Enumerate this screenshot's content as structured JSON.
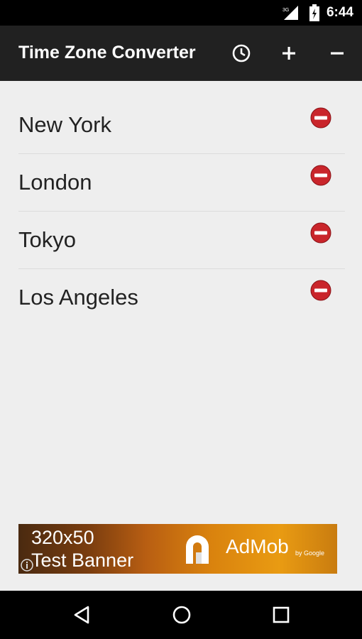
{
  "status_bar": {
    "network_label": "3G",
    "time": "6:44",
    "icons": [
      "signal-icon",
      "battery-icon"
    ]
  },
  "app_bar": {
    "title": "Time Zone Converter",
    "actions": [
      "clock-icon",
      "add-icon",
      "remove-icon"
    ]
  },
  "cities": [
    {
      "name": "New York"
    },
    {
      "name": "London"
    },
    {
      "name": "Tokyo"
    },
    {
      "name": "Los Angeles"
    }
  ],
  "ad_banner": {
    "size_label": "320x50",
    "text": "Test Banner",
    "brand": "AdMob",
    "by_label": "by Google"
  },
  "nav_bar": {
    "buttons": [
      "back-icon",
      "home-icon",
      "recents-icon"
    ]
  },
  "colors": {
    "app_bar": "#212121",
    "background": "#eeeeee",
    "remove_button": "#c9252b",
    "ad_orange": "#d9820e"
  }
}
